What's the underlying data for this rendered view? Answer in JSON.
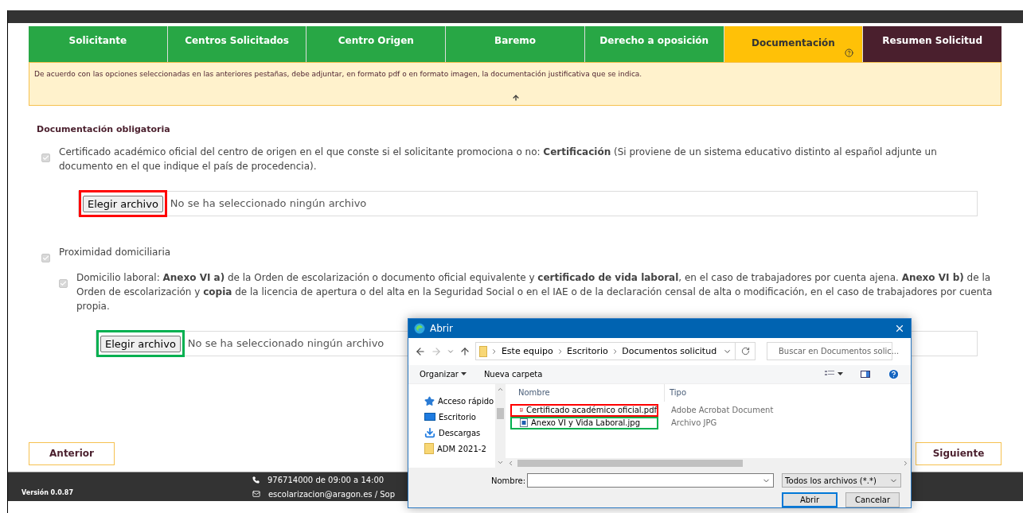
{
  "tabs": [
    {
      "label": "Solicitante",
      "selected": false,
      "kind": "step",
      "help": false
    },
    {
      "label": "Centros Solicitados",
      "selected": false,
      "kind": "step",
      "help": false
    },
    {
      "label": "Centro Origen",
      "selected": false,
      "kind": "step",
      "help": false
    },
    {
      "label": "Baremo",
      "selected": false,
      "kind": "step",
      "help": false
    },
    {
      "label": "Derecho a oposición",
      "selected": false,
      "kind": "step",
      "help": false
    },
    {
      "label": "Documentación",
      "selected": true,
      "kind": "step",
      "help": true
    },
    {
      "label": "Resumen Solicitud",
      "selected": false,
      "kind": "summary",
      "help": false
    }
  ],
  "notice": {
    "text": "De acuerdo con las opciones seleccionadas en las anteriores pestañas, debe adjuntar, en formato pdf o en formato imagen, la documentación justificativa que se indica."
  },
  "section_title": "Documentación obligatoria",
  "documents": [
    {
      "text": "Certificado académico oficial del centro de origen en el que conste si el solicitante promociona o no: **Certificación** (Si proviene de un sistema educativo distinto al español adjunte un documento en el que indique el país de procedencia).",
      "checked": true,
      "file_field": {
        "button": "Elegir archivo",
        "status": "No se ha seleccionado ningún archivo",
        "color": "#ff0000"
      }
    },
    {
      "text": "Proximidad domiciliaria",
      "checked": true,
      "children": [
        {
          "text": "Domicilio laboral: **Anexo VI a)** de la Orden de escolarización o documento oficial equivalente y **certificado de vida laboral**, en el caso de trabajadores por cuenta ajena. **Anexo VI b)** de la Orden de escolarización y **copia** de la licencia de apertura o del alta en la Seguridad Social o en el IAE o de la declaración censal de alta o modificación, en el caso de trabajadores por cuenta propia.",
          "checked": true,
          "file_field": {
            "button": "Elegir archivo",
            "status": "No se ha seleccionado ningún archivo",
            "color": "#00b050"
          }
        }
      ]
    }
  ],
  "nav_buttons": {
    "previous": "Anterior",
    "next": "Siguiente"
  },
  "footer": {
    "version": "Versión 0.0.87",
    "phone": "976714000 de 09:00 a 14:00",
    "email": "escolarizacion@aragon.es / Sop"
  },
  "dialog": {
    "title": "Abrir",
    "breadcrumbs": [
      "Este equipo",
      "Escritorio",
      "Documentos solicitud"
    ],
    "search_placeholder": "Buscar en Documentos solic...",
    "toolbar": {
      "organize": "Organizar",
      "new_folder": "Nueva carpeta"
    },
    "nav_items": [
      {
        "label": "Acceso rápido",
        "kind": "star"
      },
      {
        "label": "Escritorio",
        "kind": "desktop"
      },
      {
        "label": "Descargas",
        "kind": "download"
      },
      {
        "label": "ADM 2021-2",
        "kind": "folder"
      }
    ],
    "columns": [
      "Nombre",
      "Tipo"
    ],
    "files": [
      {
        "name": "Certificado académico oficial.pdf",
        "type": "Adobe Acrobat Document",
        "kind": "pdf",
        "color": "#ff0000"
      },
      {
        "name": "Anexo VI y Vida Laboral.jpg",
        "type": "Archivo JPG",
        "kind": "image",
        "color": "#00b050"
      }
    ],
    "filename_label": "Nombre:",
    "filter": "Todos los archivos (*.*)",
    "open_button": "Abrir",
    "cancel_button": "Cancelar"
  }
}
